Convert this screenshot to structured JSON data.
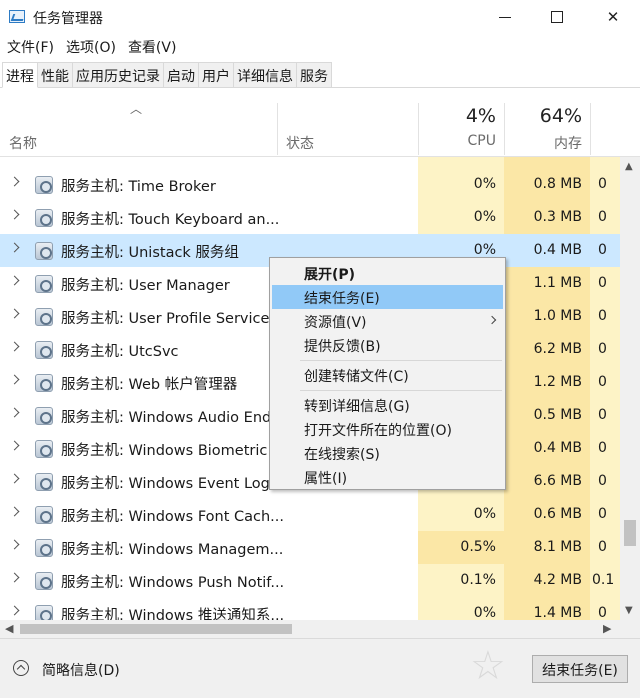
{
  "window": {
    "title": "任务管理器"
  },
  "menubar": [
    "文件(F)",
    "选项(O)",
    "查看(V)"
  ],
  "tabs": [
    "进程",
    "性能",
    "应用历史记录",
    "启动",
    "用户",
    "详细信息",
    "服务"
  ],
  "columns": {
    "name": "名称",
    "status": "状态",
    "cpu_pct": "4%",
    "cpu_label": "CPU",
    "mem_pct": "64%",
    "mem_label": "内存",
    "extra_pct": "0"
  },
  "rows": [
    {
      "name": "服务主机: Time Broker",
      "cpu": "0%",
      "mem": "0.8 MB",
      "extra": "0"
    },
    {
      "name": "服务主机: Touch Keyboard an...",
      "cpu": "0%",
      "mem": "0.3 MB",
      "extra": "0"
    },
    {
      "name": "服务主机: Unistack 服务组",
      "cpu": "0%",
      "mem": "0.4 MB",
      "extra": "0",
      "selected": true
    },
    {
      "name": "服务主机: User Manager",
      "cpu": "",
      "mem": "1.1 MB",
      "extra": "0"
    },
    {
      "name": "服务主机: User Profile Service",
      "cpu": "",
      "mem": "1.0 MB",
      "extra": "0"
    },
    {
      "name": "服务主机: UtcSvc",
      "cpu": "",
      "mem": "6.2 MB",
      "extra": "0"
    },
    {
      "name": "服务主机: Web 帐户管理器",
      "cpu": "",
      "mem": "1.2 MB",
      "extra": "0"
    },
    {
      "name": "服务主机: Windows Audio End...",
      "cpu": "",
      "mem": "0.5 MB",
      "extra": "0"
    },
    {
      "name": "服务主机: Windows Biometric ...",
      "cpu": "",
      "mem": "0.4 MB",
      "extra": "0"
    },
    {
      "name": "服务主机: Windows Event Log",
      "cpu": "",
      "mem": "6.6 MB",
      "extra": "0"
    },
    {
      "name": "服务主机: Windows Font Cach...",
      "cpu": "0%",
      "mem": "0.6 MB",
      "extra": "0"
    },
    {
      "name": "服务主机: Windows Managem...",
      "cpu": "0.5%",
      "mem": "8.1 MB",
      "extra": "0"
    },
    {
      "name": "服务主机: Windows Push Notif...",
      "cpu": "0.1%",
      "mem": "4.2 MB",
      "extra": "0.1"
    },
    {
      "name": "服务主机: Windows 推送通知系...",
      "cpu": "0%",
      "mem": "1.4 MB",
      "extra": "0"
    }
  ],
  "context_menu": [
    {
      "label": "展开(P)",
      "bold": true
    },
    {
      "label": "结束任务(E)",
      "highlighted": true
    },
    {
      "label": "资源值(V)",
      "submenu": true
    },
    {
      "label": "提供反馈(B)"
    },
    {
      "separator": true
    },
    {
      "label": "创建转储文件(C)"
    },
    {
      "separator": true
    },
    {
      "label": "转到详细信息(G)"
    },
    {
      "label": "打开文件所在的位置(O)"
    },
    {
      "label": "在线搜索(S)"
    },
    {
      "label": "属性(I)"
    }
  ],
  "footer": {
    "less_details": "简略信息(D)",
    "end_task": "结束任务(E)"
  }
}
